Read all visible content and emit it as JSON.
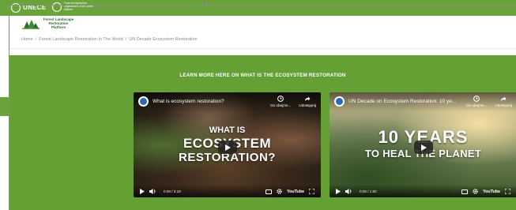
{
  "top_bar": {
    "unece_label": "UNECE",
    "fao_text": "Food and Agriculture Organization of the United Nations"
  },
  "brand": {
    "name": "Forest Landscape Restoration Platform"
  },
  "breadcrumb": {
    "home": "Home",
    "parent": "Forest Landscape Restoration In The World",
    "current": "UN Decade Ecosystem Restoration",
    "separator": "/"
  },
  "section": {
    "title": "LEARN MORE HERE ON WHAT IS THE ECOSYSTEM RESTORATION"
  },
  "videos": [
    {
      "title": "What is ecosystem restoration?",
      "watch_later": "Do obejrze...",
      "share": "Udostępnij",
      "overlay_lines": [
        "WHAT IS",
        "ECOSYSTEM",
        "RESTORATION?"
      ],
      "time": "0:00 / 3:19",
      "platform": "YouTube"
    },
    {
      "title": "UN Decade on Ecosystem Restoration: 10 ye...",
      "watch_later": "Do obejrze...",
      "share": "Udostępnij",
      "overlay_lines": [
        "10 YEARS",
        "TO HEAL THE PLANET"
      ],
      "time": "0:00 / 1:00",
      "platform": "YouTube"
    }
  ],
  "colors": {
    "green": "#64a034",
    "top_strip": "#6aa33a"
  }
}
